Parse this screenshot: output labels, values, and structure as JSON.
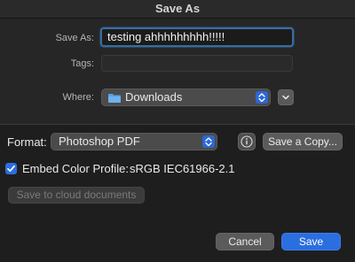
{
  "window": {
    "title": "Save As"
  },
  "top": {
    "save_as_label": "Save As:",
    "save_as_value": "testing ahhhhhhhhh!!!!!",
    "tags_label": "Tags:",
    "tags_value": "",
    "where_label": "Where:",
    "where_value": "Downloads"
  },
  "options": {
    "format_label": "Format:",
    "format_value": "Photoshop PDF",
    "save_copy_label": "Save a Copy...",
    "embed_label": "Embed Color Profile:",
    "embed_checked": true,
    "profile_value": "sRGB IEC61966-2.1",
    "cloud_button_label": "Save to cloud documents"
  },
  "footer": {
    "cancel_label": "Cancel",
    "save_label": "Save"
  },
  "colors": {
    "accent": "#2b6ee0",
    "focus_ring": "#3d6b9a",
    "folder": "#5aa0e6"
  },
  "icons": {
    "where_icon": "folder-icon",
    "stepper": "up-down-chevrons-icon",
    "expand": "chevron-down-icon",
    "info": "info-icon",
    "checkbox": "checkmark-icon"
  }
}
